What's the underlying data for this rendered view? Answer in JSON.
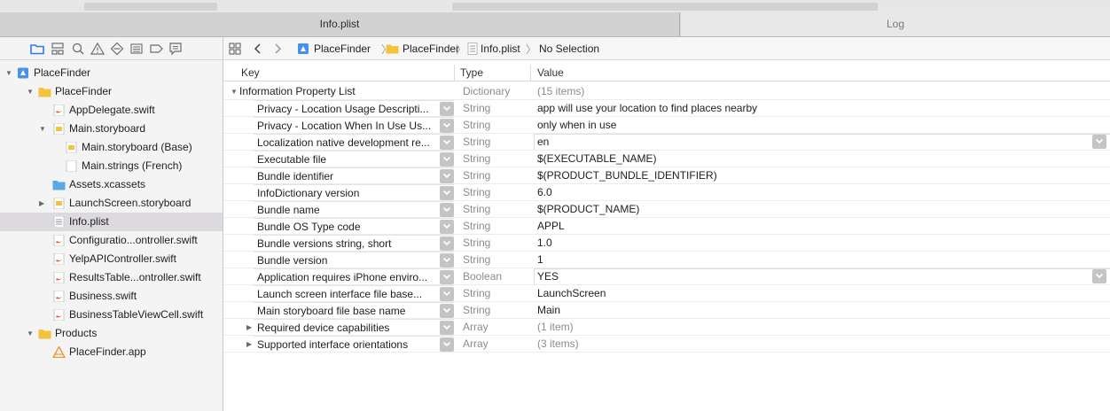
{
  "tabs": [
    {
      "label": "Info.plist",
      "selected": true
    },
    {
      "label": "Log",
      "selected": false
    }
  ],
  "navigator_icons": [
    "folder-icon",
    "hierarchy-icon",
    "search-icon",
    "warning-icon",
    "test-icon",
    "debug-icon",
    "breakpoint-icon",
    "report-icon"
  ],
  "sidebar": {
    "items": [
      {
        "label": "PlaceFinder",
        "icon": "project-icon",
        "disclosure": "open"
      },
      {
        "label": "PlaceFinder",
        "icon": "folder-icon",
        "disclosure": "open"
      },
      {
        "label": "AppDelegate.swift",
        "icon": "swift-file-icon"
      },
      {
        "label": "Main.storyboard",
        "icon": "storyboard-icon",
        "disclosure": "open"
      },
      {
        "label": "Main.storyboard (Base)",
        "icon": "storyboard-icon"
      },
      {
        "label": "Main.strings (French)",
        "icon": "strings-file-icon"
      },
      {
        "label": "Assets.xcassets",
        "icon": "assets-folder-icon"
      },
      {
        "label": "LaunchScreen.storyboard",
        "icon": "storyboard-icon",
        "disclosure": "closed"
      },
      {
        "label": "Info.plist",
        "icon": "plist-file-icon",
        "selected": true
      },
      {
        "label": "Configuratio...ontroller.swift",
        "icon": "swift-file-icon"
      },
      {
        "label": "YelpAPIController.swift",
        "icon": "swift-file-icon"
      },
      {
        "label": "ResultsTable...ontroller.swift",
        "icon": "swift-file-icon"
      },
      {
        "label": "Business.swift",
        "icon": "swift-file-icon"
      },
      {
        "label": "BusinessTableViewCell.swift",
        "icon": "swift-file-icon"
      },
      {
        "label": "Products",
        "icon": "folder-icon",
        "disclosure": "open"
      },
      {
        "label": "PlaceFinder.app",
        "icon": "app-icon"
      }
    ]
  },
  "jumpbar": {
    "crumbs": [
      "PlaceFinder",
      "PlaceFinder",
      "Info.plist",
      "No Selection"
    ]
  },
  "plist": {
    "headers": {
      "key": "Key",
      "type": "Type",
      "value": "Value"
    },
    "root": {
      "key": "Information Property List",
      "type": "Dictionary",
      "value": "(15 items)"
    },
    "rows": [
      {
        "key": "Privacy - Location Usage Descripti...",
        "type": "String",
        "value": "app will use your location to find places nearby"
      },
      {
        "key": "Privacy - Location When In Use Us...",
        "type": "String",
        "value": "only when in use"
      },
      {
        "key": "Localization native development re...",
        "type": "String",
        "value": "en",
        "value_popup": true
      },
      {
        "key": "Executable file",
        "type": "String",
        "value": "$(EXECUTABLE_NAME)"
      },
      {
        "key": "Bundle identifier",
        "type": "String",
        "value": "$(PRODUCT_BUNDLE_IDENTIFIER)"
      },
      {
        "key": "InfoDictionary version",
        "type": "String",
        "value": "6.0"
      },
      {
        "key": "Bundle name",
        "type": "String",
        "value": "$(PRODUCT_NAME)"
      },
      {
        "key": "Bundle OS Type code",
        "type": "String",
        "value": "APPL"
      },
      {
        "key": "Bundle versions string, short",
        "type": "String",
        "value": "1.0"
      },
      {
        "key": "Bundle version",
        "type": "String",
        "value": "1"
      },
      {
        "key": "Application requires iPhone enviro...",
        "type": "Boolean",
        "value": "YES",
        "value_popup": true
      },
      {
        "key": "Launch screen interface file base...",
        "type": "String",
        "value": "LaunchScreen"
      },
      {
        "key": "Main storyboard file base name",
        "type": "String",
        "value": "Main"
      },
      {
        "key": "Required device capabilities",
        "type": "Array",
        "value": "(1 item)",
        "expandable": true
      },
      {
        "key": "Supported interface orientations",
        "type": "Array",
        "value": "(3 items)",
        "expandable": true
      }
    ]
  },
  "colors": {
    "accent": "#2f7bf5",
    "folder": "#f5c33b",
    "swift": "#f05138",
    "selection": "#dcd9df"
  }
}
